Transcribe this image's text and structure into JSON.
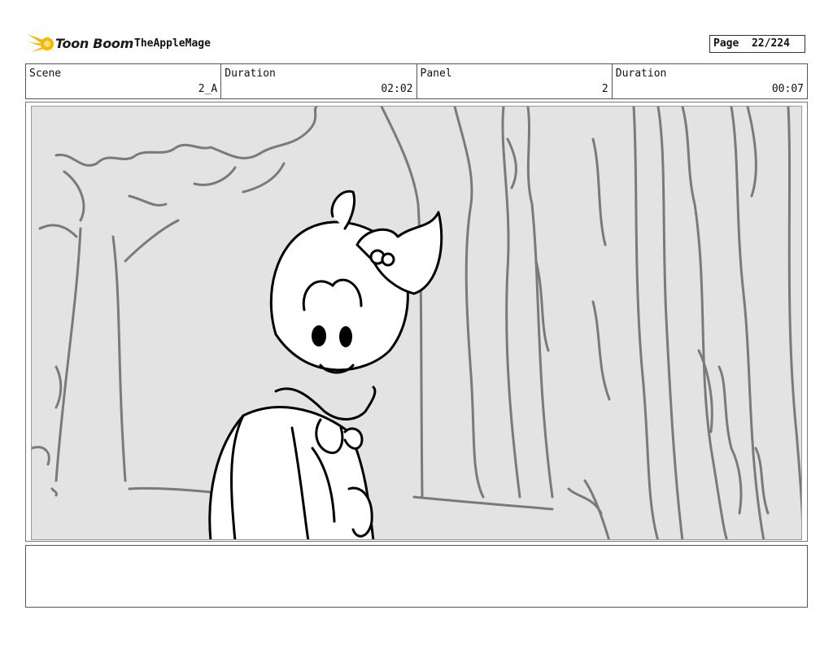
{
  "header": {
    "brand": "Toon Boom",
    "project": "TheAppleMage",
    "page_label": "Page",
    "page_value": "22/224"
  },
  "info": [
    {
      "label": "Scene",
      "value": "2_A"
    },
    {
      "label": "Duration",
      "value": "02:02"
    },
    {
      "label": "Panel",
      "value": "2"
    },
    {
      "label": "Duration",
      "value": "00:07"
    }
  ],
  "notes": "",
  "colors": {
    "logo_yellow": "#f5b800",
    "panel_bg": "#e3e3e3",
    "tree_line": "#7a7a7a",
    "character_line": "#000000"
  }
}
